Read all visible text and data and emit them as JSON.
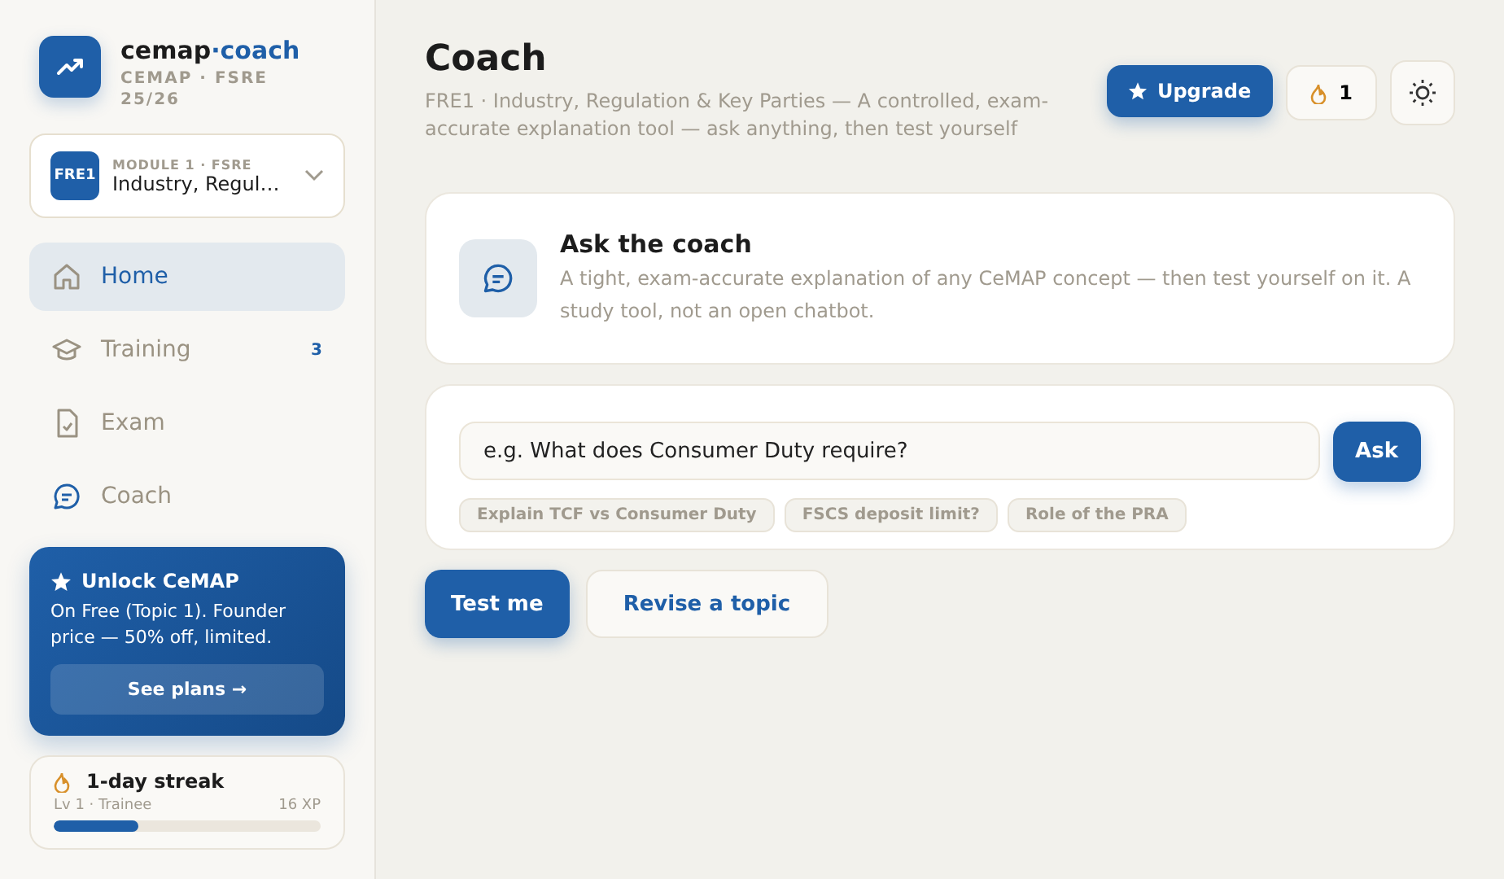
{
  "brand": {
    "name_part1": "cemap",
    "name_part2": "·coach",
    "subtitle": "CEMAP · FSRE 25/26"
  },
  "module_picker": {
    "badge": "FRE1",
    "label": "MODULE 1 · FSRE",
    "value": "Industry, Regul…"
  },
  "nav": [
    {
      "label": "Home",
      "selected": true
    },
    {
      "label": "Training",
      "selected": false,
      "count": "3"
    },
    {
      "label": "Exam",
      "selected": false
    },
    {
      "label": "Coach",
      "selected": false
    }
  ],
  "promo": {
    "title": "Unlock CeMAP",
    "text": "On Free (Topic 1). Founder price — 50% off, limited.",
    "button": "See plans →"
  },
  "streak": {
    "title": "1-day streak",
    "level_label": "Lv 1 · Trainee",
    "xp": "16 XP",
    "level": 0.32
  },
  "header": {
    "title": "Coach",
    "subtitle": "FRE1 · Industry, Regulation & Key Parties — A controlled, exam-accurate explanation tool — ask anything, then test yourself",
    "upgrade": "Upgrade",
    "streak_count": "1"
  },
  "intro": {
    "title": "Ask the coach",
    "text": "A tight, exam-accurate explanation of any CeMAP concept — then test yourself on it. A study tool, not an open chatbot."
  },
  "ask": {
    "placeholder": "e.g. What does Consumer Duty require?",
    "button": "Ask",
    "suggestions": [
      "Explain TCF vs Consumer Duty",
      "FSCS deposit limit?",
      "Role of the PRA"
    ]
  },
  "actions": [
    {
      "label": "Test me",
      "kind": "primary"
    },
    {
      "label": "Revise a topic",
      "kind": "secondary"
    }
  ]
}
